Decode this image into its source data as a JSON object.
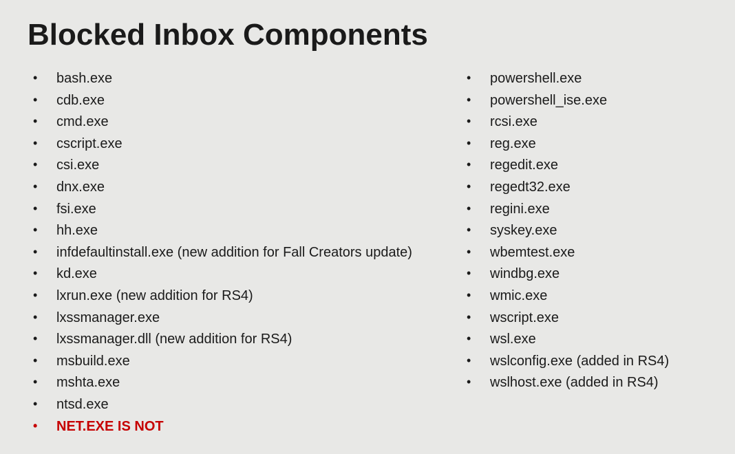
{
  "title": "Blocked Inbox Components",
  "left_items": [
    {
      "text": "bash.exe",
      "highlight": false
    },
    {
      "text": "cdb.exe",
      "highlight": false
    },
    {
      "text": "cmd.exe",
      "highlight": false
    },
    {
      "text": "cscript.exe",
      "highlight": false
    },
    {
      "text": "csi.exe",
      "highlight": false
    },
    {
      "text": "dnx.exe",
      "highlight": false
    },
    {
      "text": "fsi.exe",
      "highlight": false
    },
    {
      "text": "hh.exe",
      "highlight": false
    },
    {
      "text": "infdefaultinstall.exe (new addition for Fall Creators update)",
      "highlight": false
    },
    {
      "text": "kd.exe",
      "highlight": false
    },
    {
      "text": "lxrun.exe (new addition for RS4)",
      "highlight": false
    },
    {
      "text": "lxssmanager.exe",
      "highlight": false
    },
    {
      "text": "lxssmanager.dll (new addition for RS4)",
      "highlight": false
    },
    {
      "text": "msbuild.exe",
      "highlight": false
    },
    {
      "text": "mshta.exe",
      "highlight": false
    },
    {
      "text": "ntsd.exe",
      "highlight": false
    },
    {
      "text": "NET.EXE IS NOT",
      "highlight": true
    }
  ],
  "right_items": [
    {
      "text": "powershell.exe",
      "highlight": false
    },
    {
      "text": "powershell_ise.exe",
      "highlight": false
    },
    {
      "text": "rcsi.exe",
      "highlight": false
    },
    {
      "text": "reg.exe",
      "highlight": false
    },
    {
      "text": "regedit.exe",
      "highlight": false
    },
    {
      "text": "regedt32.exe",
      "highlight": false
    },
    {
      "text": "regini.exe",
      "highlight": false
    },
    {
      "text": "syskey.exe",
      "highlight": false
    },
    {
      "text": "wbemtest.exe",
      "highlight": false
    },
    {
      "text": "windbg.exe",
      "highlight": false
    },
    {
      "text": "wmic.exe",
      "highlight": false
    },
    {
      "text": "wscript.exe",
      "highlight": false
    },
    {
      "text": "wsl.exe",
      "highlight": false
    },
    {
      "text": "wslconfig.exe (added in RS4)",
      "highlight": false
    },
    {
      "text": "wslhost.exe (added in RS4)",
      "highlight": false
    }
  ]
}
